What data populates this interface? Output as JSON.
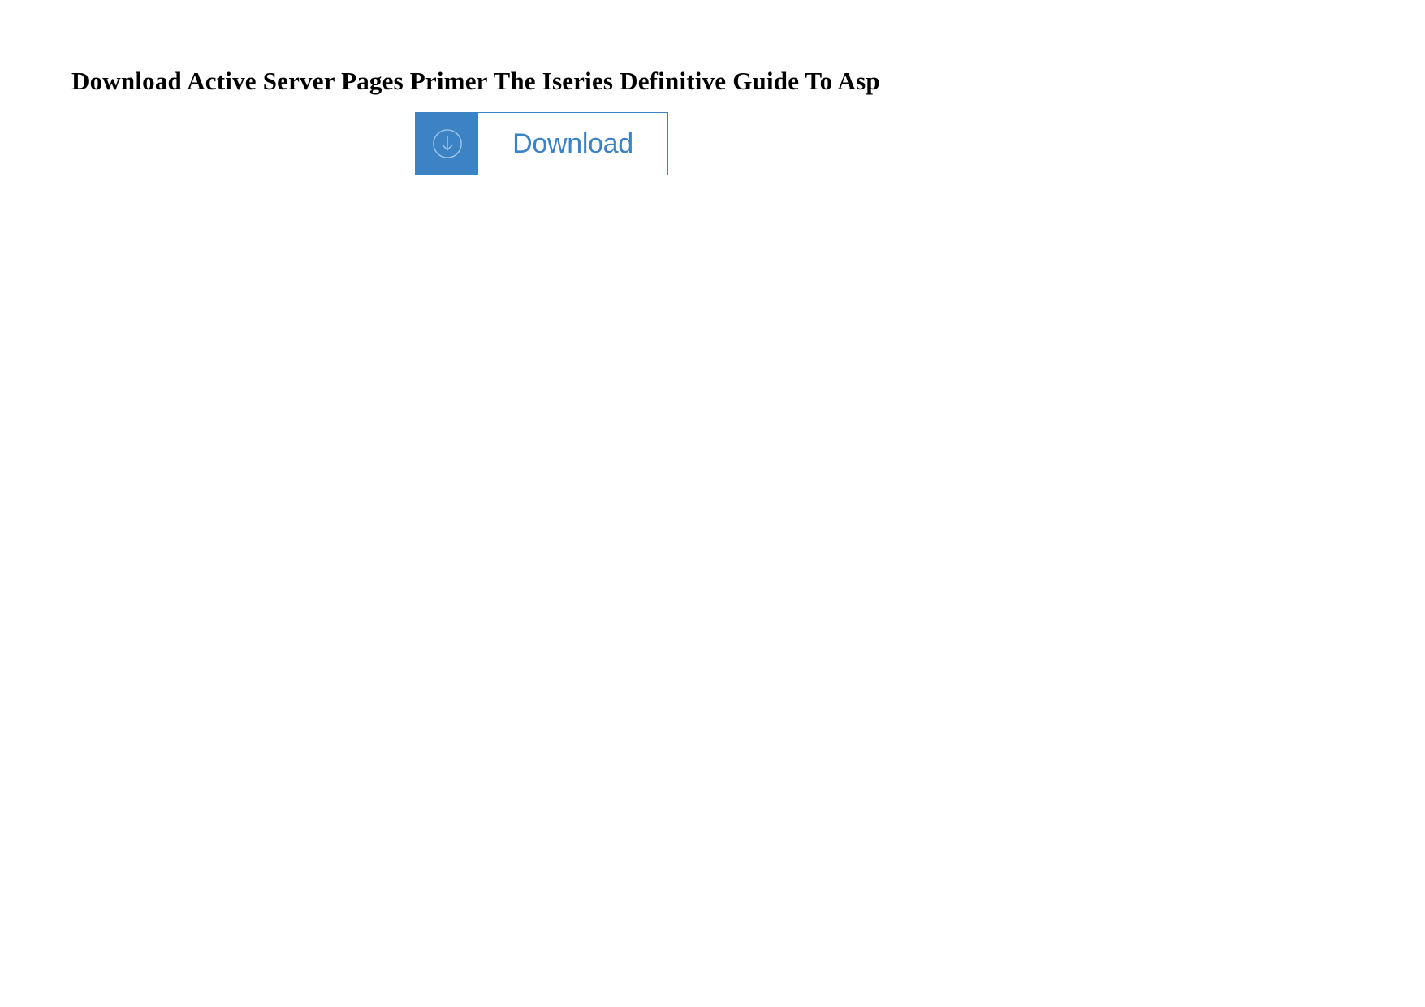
{
  "title": "Download Active Server Pages Primer The Iseries Definitive Guide To Asp",
  "button": {
    "label": "Download",
    "icon_name": "download-circle-icon"
  },
  "colors": {
    "accent": "#3b83c5"
  }
}
